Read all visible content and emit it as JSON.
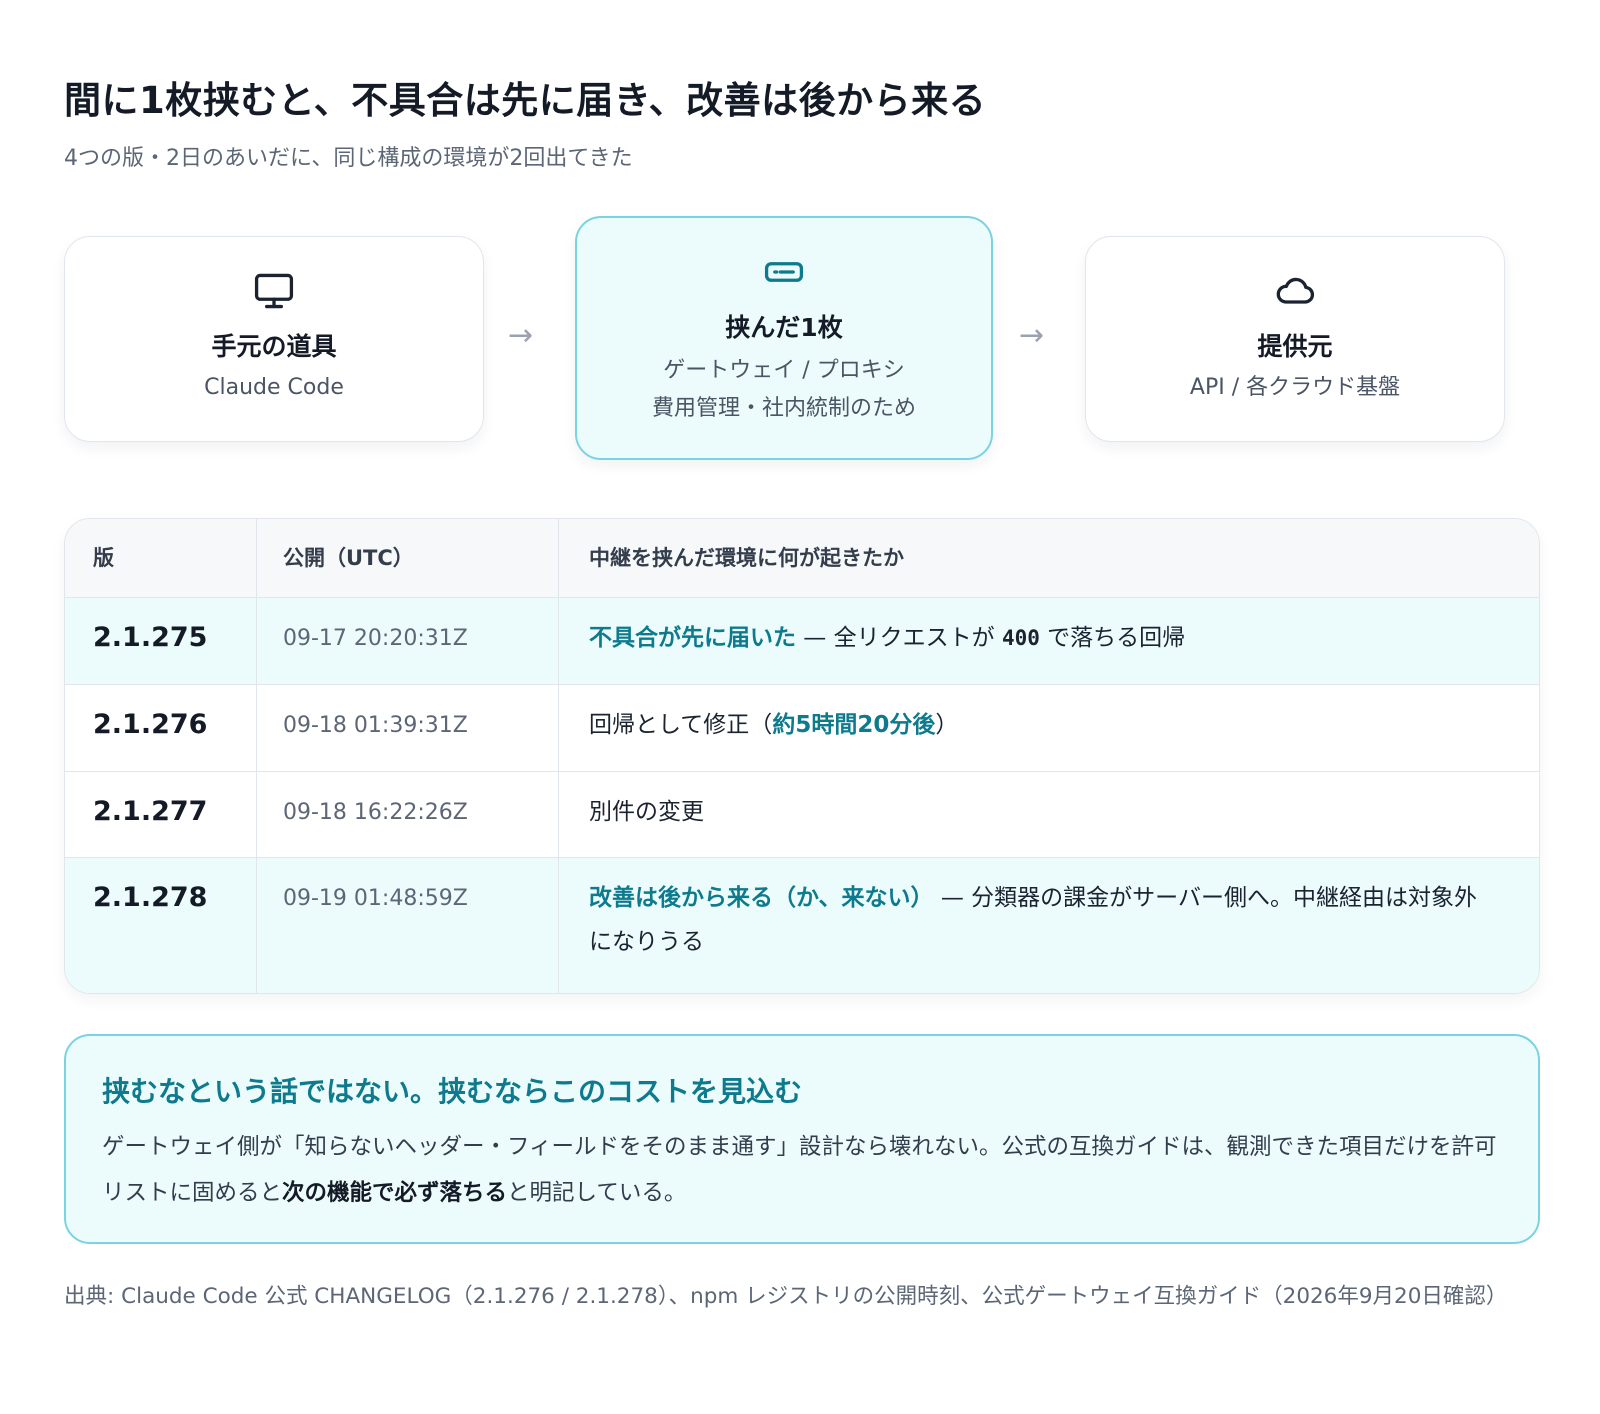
{
  "header": {
    "title": "間に1枚挟むと、不具合は先に届き、改善は後から来る",
    "subtitle": "4つの版・2日のあいだに、同じ構成の環境が2回出てきた"
  },
  "flow": {
    "arrow": "→",
    "nodes": [
      {
        "icon": "monitor-icon",
        "title": "手元の道具",
        "sub": "Claude Code"
      },
      {
        "icon": "gateway-icon",
        "title": "挟んだ1枚",
        "sub": "ゲートウェイ / プロキシ",
        "sub2": "費用管理・社内統制のため"
      },
      {
        "icon": "cloud-icon",
        "title": "提供元",
        "sub": "API / 各クラウド基盤"
      }
    ]
  },
  "table": {
    "headers": [
      "版",
      "公開（UTC）",
      "中継を挟んだ環境に何が起きたか"
    ],
    "rows": [
      {
        "version": "2.1.275",
        "time": "09-17 20:20:31Z",
        "accent": "不具合が先に届いた",
        "text_a": " — 全リクエストが ",
        "code": "400",
        "text_b": " で落ちる回帰"
      },
      {
        "version": "2.1.276",
        "time": "09-18 01:39:31Z",
        "text_a": "回帰として修正（",
        "accent": "約5時間20分後",
        "text_b": "）"
      },
      {
        "version": "2.1.277",
        "time": "09-18 16:22:26Z",
        "text_a": "別件の変更"
      },
      {
        "version": "2.1.278",
        "time": "09-19 01:48:59Z",
        "accent": "改善は後から来る（か、来ない）",
        "text_a": " — 分類器の課金がサーバー側へ。中継経由は対象外になりうる"
      }
    ]
  },
  "note": {
    "title": "挟むなという話ではない。挟むならこのコストを見込む",
    "body_a": "ゲートウェイ側が「知らないヘッダー・フィールドをそのまま通す」設計なら壊れない。公式の互換ガイドは、観測できた項目だけを許可リストに固めると",
    "body_bold": "次の機能で必ず落ちる",
    "body_b": "と明記している。"
  },
  "source": "出典: Claude Code 公式 CHANGELOG（2.1.276 / 2.1.278）、npm レジストリの公開時刻、公式ゲートウェイ互換ガイド（2026年9月20日確認）",
  "colors": {
    "accent": "#0e7a8d",
    "highlight_bg": "#ecfcfd",
    "highlight_border": "#7ad3e0"
  }
}
